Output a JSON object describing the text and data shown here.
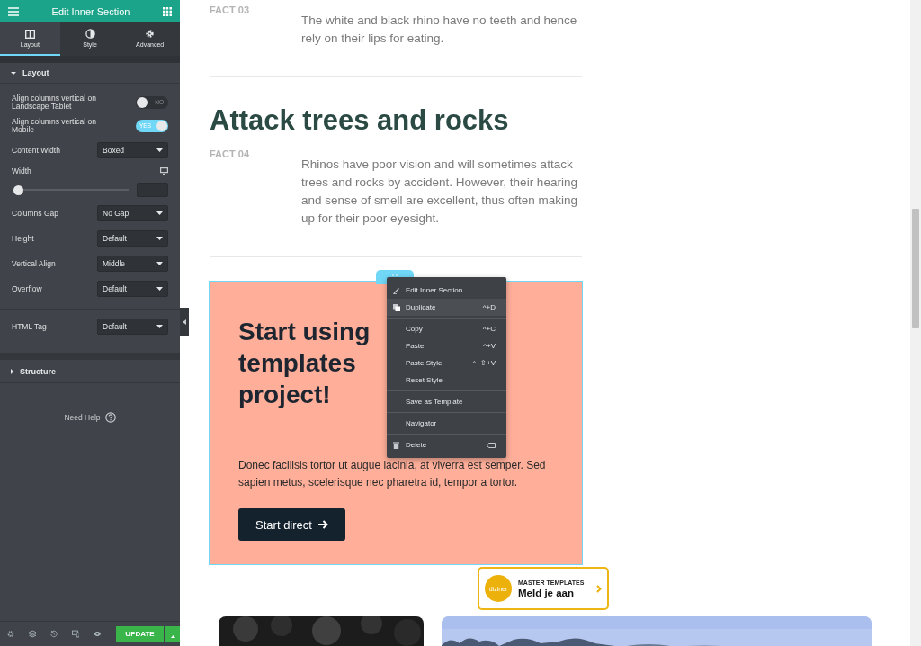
{
  "sidebar": {
    "title": "Edit Inner Section",
    "tabs": [
      {
        "label": "Layout",
        "kind": "layout",
        "selected": true
      },
      {
        "label": "Style",
        "kind": "style",
        "selected": false
      },
      {
        "label": "Advanced",
        "kind": "advanced",
        "selected": false
      }
    ],
    "section": {
      "title": "Layout",
      "expanded": true
    },
    "controls": [
      {
        "kind": "switch",
        "label": "Align columns vertical on Landscape Tablet",
        "on": false,
        "switch_text": "NO"
      },
      {
        "kind": "switch",
        "label": "Align columns vertical on Mobile",
        "on": true,
        "switch_text": "YES"
      },
      {
        "kind": "select",
        "label": "Content Width",
        "value": "Boxed",
        "divider_before": false
      },
      {
        "kind": "slider",
        "label": "Width",
        "level": 0
      },
      {
        "kind": "select",
        "label": "Columns Gap",
        "value": "No Gap",
        "divider_before": false
      },
      {
        "kind": "select",
        "label": "Height",
        "value": "Default",
        "divider_before": false
      },
      {
        "kind": "select",
        "label": "Vertical Align",
        "value": "Middle",
        "divider_before": false
      },
      {
        "kind": "select",
        "label": "Overflow",
        "value": "Default",
        "divider_before": false
      },
      {
        "kind": "select",
        "label": "HTML Tag",
        "value": "Default",
        "divider_before": true
      }
    ],
    "structure": {
      "title": "Structure",
      "expanded": false
    },
    "help": "Need Help",
    "update_button": "UPDATE"
  },
  "page": {
    "content": [
      {
        "kind": "fact",
        "label": "FACT 03",
        "text": "The white and black rhino have no teeth and hence rely on their lips for eating."
      },
      {
        "kind": "divider"
      },
      {
        "kind": "heading",
        "text": "Attack trees and rocks"
      },
      {
        "kind": "fact",
        "label": "FACT 04",
        "text": "Rhinos have poor vision and will sometimes attack trees and rocks by accident. However, their hearing and sense of smell are excellent, thus often making up for their poor eyesight."
      },
      {
        "kind": "divider"
      }
    ],
    "section": {
      "selected": true,
      "heading_lines": [
        "Start using",
        "templates",
        "project!"
      ],
      "text": "Donec facilisis tortor ut augue lacinia, at viverra est semper. Sed sapien metus, scelerisque nec pharetra id, tempor a tortor.",
      "button": "Start direct"
    },
    "context_menu": [
      [
        {
          "kind": "edit",
          "label": "Edit Inner Section",
          "selected": false
        },
        {
          "kind": "duplicate",
          "label": "Duplicate",
          "shortcut": "^+D",
          "selected": true
        }
      ],
      [
        {
          "kind": "plain",
          "label": "Copy",
          "shortcut": "^+C",
          "selected": false
        },
        {
          "kind": "plain",
          "label": "Paste",
          "shortcut": "^+V",
          "selected": false
        },
        {
          "kind": "plain",
          "label": "Paste Style",
          "shortcut": "^+⇧+V",
          "selected": false
        },
        {
          "kind": "plain",
          "label": "Reset Style",
          "selected": false
        }
      ],
      [
        {
          "kind": "plain",
          "label": "Save as Template",
          "selected": false
        }
      ],
      [
        {
          "kind": "plain",
          "label": "Navigator",
          "selected": false
        }
      ],
      [
        {
          "kind": "delete",
          "label": "Delete",
          "selected": false
        }
      ]
    ],
    "badge": {
      "logo": "diziner",
      "kicker": "MASTER TEMPLATES",
      "title": "Meld je aan"
    },
    "pictures": [
      {
        "kind": "picture"
      },
      {
        "kind": "picture"
      }
    ]
  }
}
